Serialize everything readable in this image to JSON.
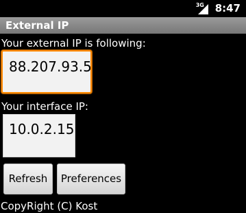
{
  "status_bar": {
    "network_type": "3G",
    "signal_icon": "signal-strength-icon",
    "time": "8:47"
  },
  "app": {
    "title": "External IP"
  },
  "external_ip": {
    "label": "Your external IP is following:",
    "value": "88.207.93.5"
  },
  "interface_ip": {
    "label": "Your interface IP:",
    "value": "10.0.2.15"
  },
  "buttons": {
    "refresh_label": "Refresh",
    "preferences_label": "Preferences"
  },
  "footer": {
    "copyright": "CopyRight (C) Kost"
  },
  "colors": {
    "focus_border": "#ff8a00",
    "title_bar": "#8a8a8a",
    "background": "#000000"
  }
}
